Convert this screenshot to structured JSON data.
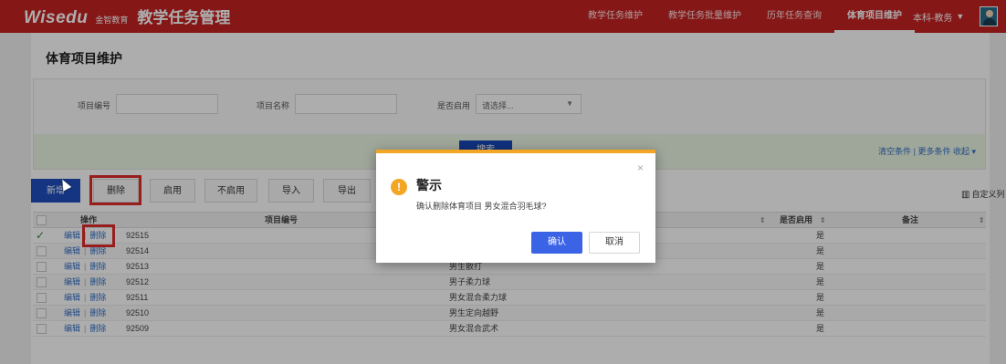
{
  "header": {
    "brand": "Wisedu",
    "brand_sub": "金智教育",
    "system_title": "教学任务管理",
    "nav": [
      "教学任务维护",
      "教学任务批量维护",
      "历年任务查询",
      "体育项目维护"
    ],
    "active_nav": "体育项目维护",
    "user_label": "本科-教务"
  },
  "page": {
    "title": "体育项目维护"
  },
  "search": {
    "field1_label": "项目编号",
    "field1_value": "",
    "field2_label": "项目名称",
    "field2_value": "",
    "field3_label": "是否启用",
    "field3_placeholder": "请选择...",
    "search_button": "搜索",
    "links": "清空条件 | 更多条件   收起 ▾"
  },
  "toolbar": {
    "buttons": [
      "新增",
      "删除",
      "启用",
      "不启用",
      "导入",
      "导出"
    ],
    "custom_columns": "自定义列"
  },
  "table": {
    "headers": {
      "op": "操作",
      "code": "项目编号",
      "enabled": "是否启用",
      "remark": "备注"
    },
    "edit_label": "编辑",
    "delete_label": "删除",
    "rows": [
      {
        "code": "92515",
        "name": "",
        "enabled": "是",
        "checked": true
      },
      {
        "code": "92514",
        "name": "",
        "enabled": "是",
        "checked": false
      },
      {
        "code": "92513",
        "name": "男生散打",
        "enabled": "是",
        "checked": false
      },
      {
        "code": "92512",
        "name": "男子柔力球",
        "enabled": "是",
        "checked": false
      },
      {
        "code": "92511",
        "name": "男女混合柔力球",
        "enabled": "是",
        "checked": false
      },
      {
        "code": "92510",
        "name": "男生定向越野",
        "enabled": "是",
        "checked": false
      },
      {
        "code": "92509",
        "name": "男女混合武术",
        "enabled": "是",
        "checked": false
      }
    ]
  },
  "dialog": {
    "title": "警示",
    "message": "确认删除体育项目 男女混合羽毛球?",
    "ok": "确认",
    "cancel": "取消",
    "close": "×",
    "icon": "!"
  },
  "colors": {
    "topbar": "#c62222",
    "primary": "#1f4fc1",
    "warning": "#f2a623",
    "highlight": "#e02b2b"
  }
}
